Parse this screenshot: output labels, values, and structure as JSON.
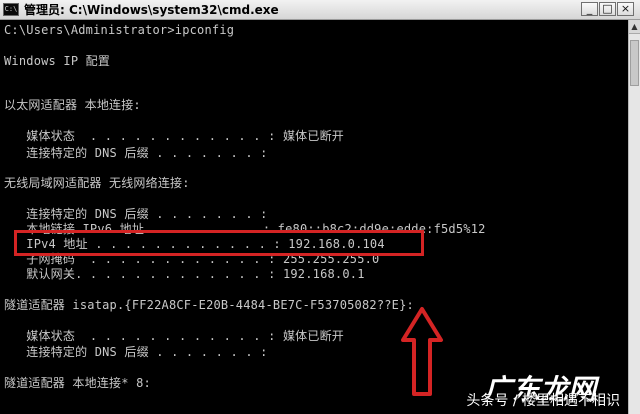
{
  "window": {
    "icon_text": "C:\\",
    "title": "管理员: C:\\Windows\\system32\\cmd.exe",
    "buttons": {
      "minimize": "_",
      "maximize": "□",
      "close": "×"
    }
  },
  "console": {
    "prompt": "C:\\Users\\Administrator>ipconfig",
    "header": "Windows IP 配置",
    "ethernet_header": "以太网适配器 本地连接:",
    "ethernet_rows": [
      "   媒体状态  . . . . . . . . . . . . : 媒体已断开",
      "   连接特定的 DNS 后缀 . . . . . . . :"
    ],
    "wireless_header": "无线局域网适配器 无线网络连接:",
    "wireless_rows": [
      "   连接特定的 DNS 后缀 . . . . . . . :",
      "   本地链接 IPv6 地址. . . . . . . . : fe80::b8c2:dd9e:edde:f5d5%12",
      "   IPv4 地址 . . . . . . . . . . . . : 192.168.0.104",
      "   子网掩码  . . . . . . . . . . . . : 255.255.255.0",
      "   默认网关. . . . . . . . . . . . . : 192.168.0.1"
    ],
    "tunnel1_header": "隧道适配器 isatap.{FF22A8CF-E20B-4484-BE7C-F53705082??E}:",
    "tunnel1_rows": [
      "   媒体状态  . . . . . . . . . . . . : 媒体已断开",
      "   连接特定的 DNS 后缀 . . . . . . . :"
    ],
    "tunnel2_header": "隧道适配器 本地连接* 8:"
  },
  "annotation": {
    "highlight_color": "#d42424",
    "arrow_color": "#d42424"
  },
  "watermark": {
    "site": "广东龙网",
    "credit": "头条号 / 楼里相遇不相识"
  },
  "icons": {
    "scroll_up": "scroll-up-arrow-icon",
    "app": "cmd-app-icon"
  }
}
